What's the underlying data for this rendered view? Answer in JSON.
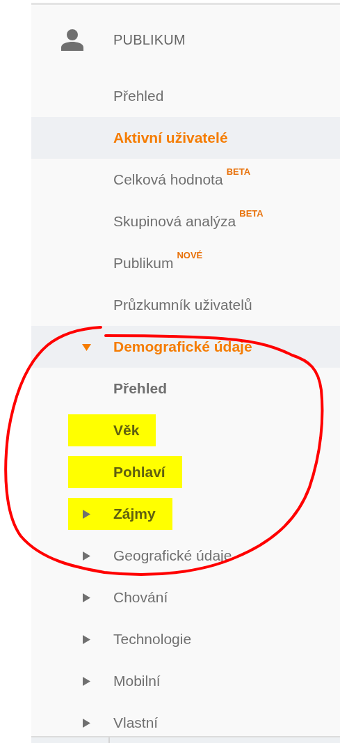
{
  "section": {
    "title": "PUBLIKUM"
  },
  "items": [
    {
      "label": "Přehled",
      "kind": "link",
      "selected": false
    },
    {
      "label": "Aktivní uživatelé",
      "kind": "link",
      "selected": true
    },
    {
      "label": "Celková hodnota",
      "tag": "BETA",
      "kind": "link",
      "selected": false
    },
    {
      "label": "Skupinová analýza",
      "tag": "BETA",
      "kind": "link",
      "selected": false
    },
    {
      "label": "Publikum",
      "tag": "NOVÉ",
      "kind": "link",
      "selected": false
    },
    {
      "label": "Průzkumník uživatelů",
      "kind": "link",
      "selected": false
    },
    {
      "label": "Demografické údaje",
      "kind": "folder",
      "expanded": true,
      "selected": true,
      "children": [
        {
          "label": "Přehled",
          "kind": "link",
          "selected": false,
          "highlighted": false
        },
        {
          "label": "Věk",
          "kind": "link",
          "selected": false,
          "highlighted": true
        },
        {
          "label": "Pohlaví",
          "kind": "link",
          "selected": false,
          "highlighted": true
        },
        {
          "label": "Zájmy",
          "kind": "folder",
          "expanded": false,
          "selected": false,
          "highlighted": true
        }
      ]
    },
    {
      "label": "Geografické údaje",
      "kind": "folder",
      "expanded": false,
      "selected": false
    },
    {
      "label": "Chování",
      "kind": "folder",
      "expanded": false,
      "selected": false
    },
    {
      "label": "Technologie",
      "kind": "folder",
      "expanded": false,
      "selected": false
    },
    {
      "label": "Mobilní",
      "kind": "folder",
      "expanded": false,
      "selected": false
    },
    {
      "label": "Vlastní",
      "kind": "folder",
      "expanded": false,
      "selected": false
    }
  ],
  "annotation": {
    "kind": "circle"
  }
}
